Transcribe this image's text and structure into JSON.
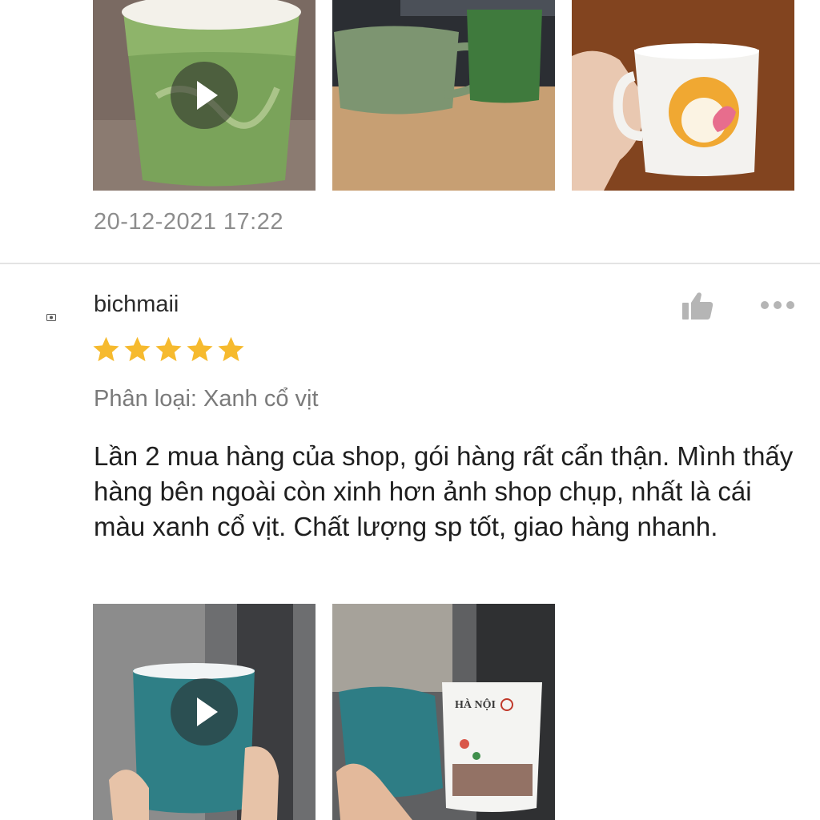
{
  "previous_review": {
    "media": [
      {
        "type": "video",
        "icon": "play-icon"
      },
      {
        "type": "image"
      },
      {
        "type": "image"
      }
    ],
    "timestamp": "20-12-2021 17:22"
  },
  "review": {
    "username": "bichmaii",
    "rating": 5,
    "rating_max": 5,
    "variation": "Phân loại: Xanh cổ vịt",
    "comment": "Lần 2 mua hàng của shop, gói hàng rất cẩn thận. Mình thấy hàng bên ngoài còn xinh hơn ảnh shop chụp, nhất là cái màu xanh cổ vịt. Chất lượng sp tốt, giao hàng nhanh.",
    "media": [
      {
        "type": "video",
        "icon": "play-icon"
      },
      {
        "type": "image"
      }
    ],
    "icons": {
      "like": "thumbs-up-icon",
      "more": "more-options-icon",
      "avatar": "avatar-icon"
    }
  },
  "colors": {
    "star": "#f6ba2e",
    "muted_text": "#8d8d8d",
    "icon_gray": "#b5b5b5",
    "divider": "#e3e3e3"
  }
}
